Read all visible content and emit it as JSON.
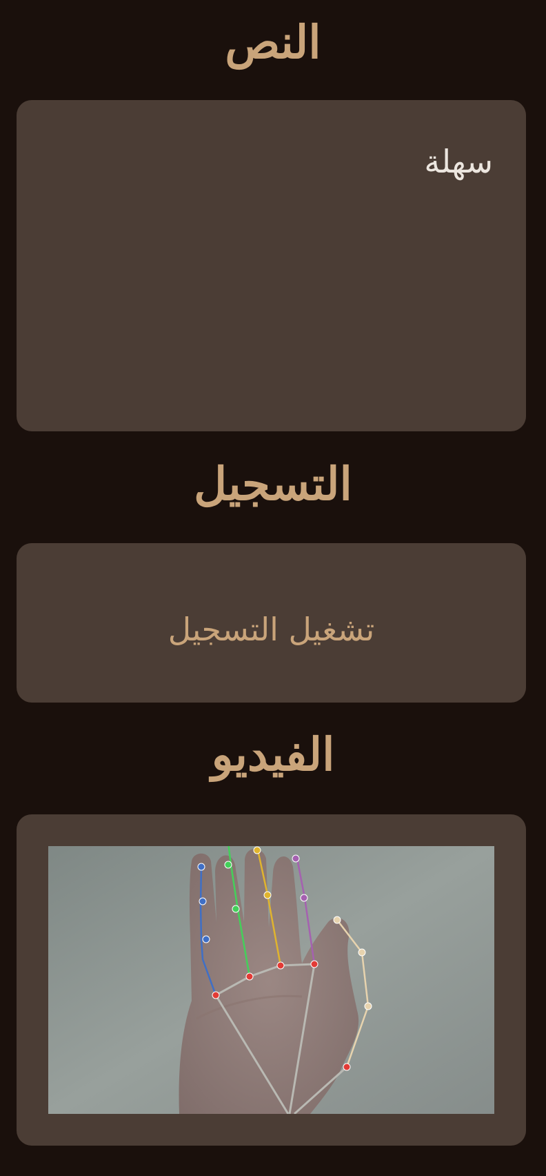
{
  "sections": {
    "text": {
      "title": "النص",
      "content": "سهلة"
    },
    "recording": {
      "title": "التسجيل",
      "play_label": "تشغيل التسجيل"
    },
    "video": {
      "title": "الفيديو"
    }
  },
  "colors": {
    "background": "#1a100c",
    "card": "#4b3d35",
    "accent": "#c9a47a",
    "text": "#ece6df"
  }
}
